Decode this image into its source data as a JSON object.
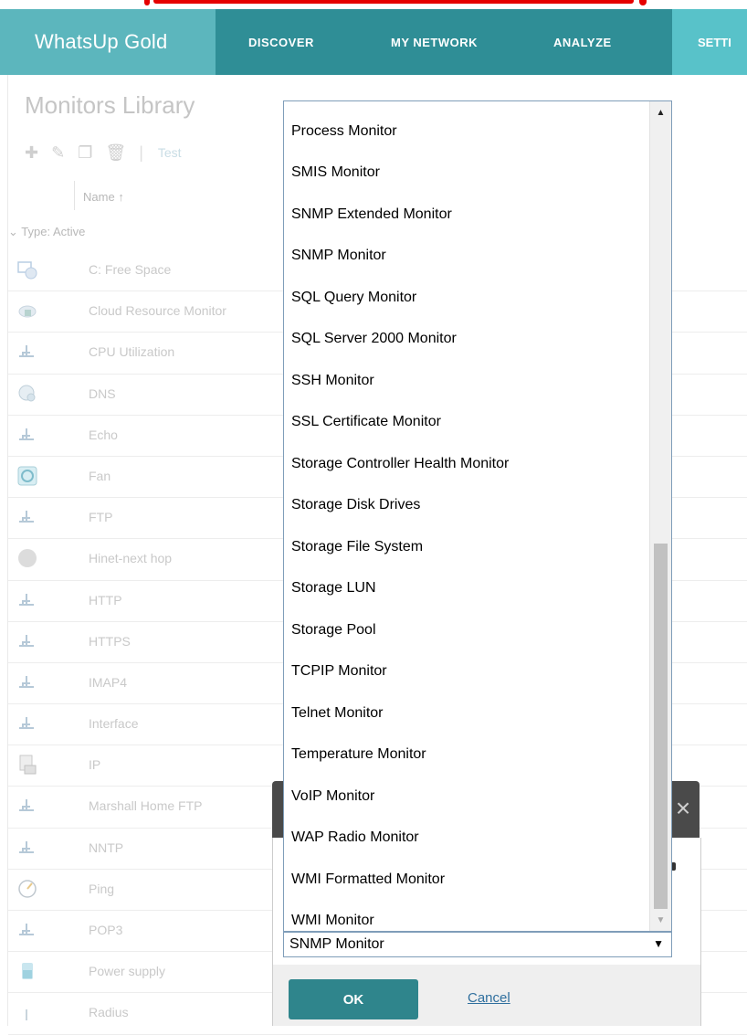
{
  "nav": {
    "brand": "WhatsUp Gold",
    "items": [
      "DISCOVER",
      "MY NETWORK",
      "ANALYZE"
    ],
    "settings": "SETTI"
  },
  "page": {
    "title": "Monitors Library",
    "toolbar_test": "Test",
    "column_name": "Name",
    "group_label": "Type: Active",
    "rows": [
      "C: Free Space",
      "Cloud Resource Monitor",
      "CPU Utilization",
      "DNS",
      "Echo",
      "Fan",
      "FTP",
      "Hinet-next hop",
      "HTTP",
      "HTTPS",
      "IMAP4",
      "Interface",
      "IP",
      "Marshall Home FTP",
      "NNTP",
      "Ping",
      "POP3",
      "Power supply",
      "Radius"
    ]
  },
  "dropdown": {
    "items": [
      "Process Monitor",
      "SMIS Monitor",
      "SNMP Extended Monitor",
      "SNMP Monitor",
      "SQL Query Monitor",
      "SQL Server 2000 Monitor",
      "SSH Monitor",
      "SSL Certificate Monitor",
      "Storage Controller Health Monitor",
      "Storage Disk Drives",
      "Storage File System",
      "Storage LUN",
      "Storage Pool",
      "TCPIP Monitor",
      "Telnet Monitor",
      "Temperature Monitor",
      "VoIP Monitor",
      "WAP Radio Monitor",
      "WMI Formatted Monitor",
      "WMI Monitor"
    ],
    "selected": "SNMP Monitor"
  },
  "dialog": {
    "ok_label": "OK",
    "cancel_label": "Cancel"
  }
}
